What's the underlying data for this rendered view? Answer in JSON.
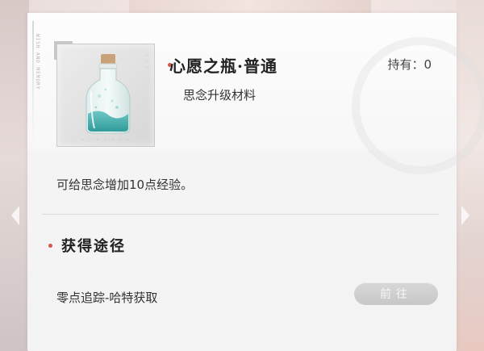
{
  "item": {
    "name": "心愿之瓶·普通",
    "type": "思念升级材料",
    "owned_text": "持有：0",
    "description": "可给思念增加10点经验。",
    "icon": "wish-bottle-icon",
    "deco_text": "WISH AND MEMORY"
  },
  "acquire": {
    "title": "获得途径",
    "sources": [
      {
        "label": "零点追踪-哈特获取",
        "button": "前往",
        "enabled": false
      }
    ]
  },
  "colors": {
    "accent_dot": "#d1574f",
    "button_disabled": "#c9c9c9"
  }
}
